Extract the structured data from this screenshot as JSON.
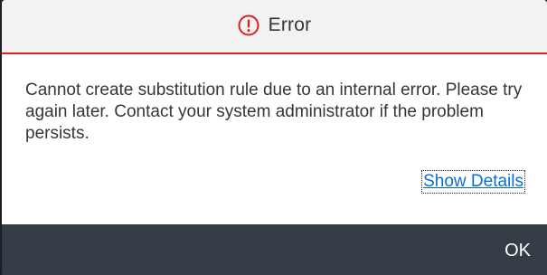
{
  "dialog": {
    "title": "Error",
    "icon": "error-circle-icon",
    "accent_color": "#e0201c",
    "message": "Cannot create substitution rule due to an internal error. Please try again later. Contact your system administrator if the problem persists.",
    "details_link": "Show Details",
    "ok_label": "OK"
  }
}
